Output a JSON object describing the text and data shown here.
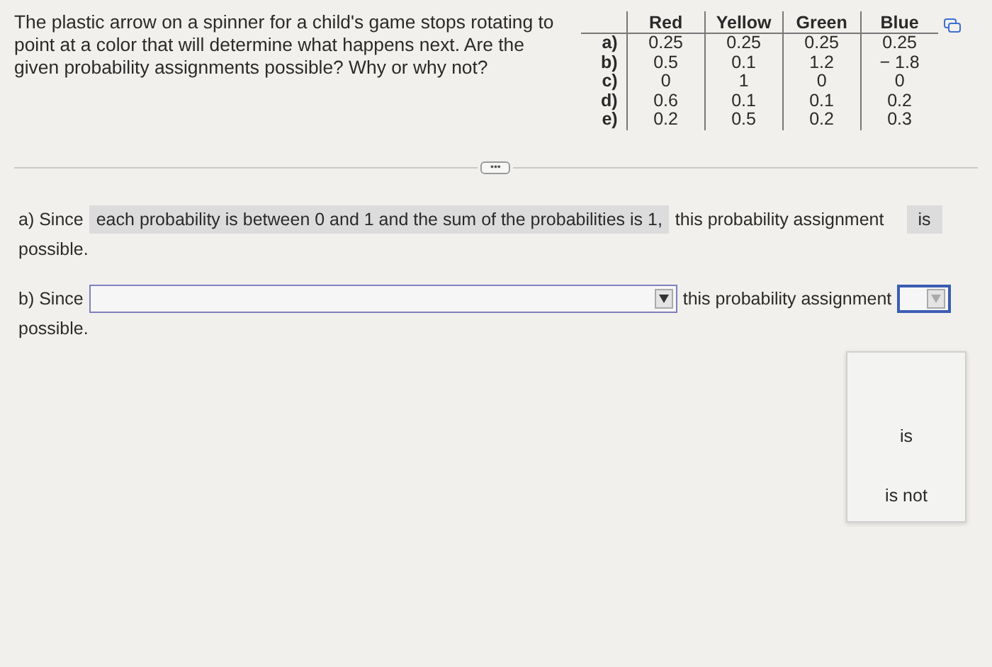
{
  "question": "The plastic arrow on a spinner for a child's game stops rotating to point at a color that will determine what happens next. Are the given probability assignments possible? Why or why not?",
  "table": {
    "columns": [
      "Red",
      "Yellow",
      "Green",
      "Blue"
    ],
    "rows": [
      {
        "label": "a)",
        "cells": [
          "0.25",
          "0.25",
          "0.25",
          "0.25"
        ]
      },
      {
        "label": "b)",
        "cells": [
          "0.5",
          "0.1",
          "1.2",
          "− 1.8"
        ]
      },
      {
        "label": "c)",
        "cells": [
          "0",
          "1",
          "0",
          "0"
        ]
      },
      {
        "label": "d)",
        "cells": [
          "0.6",
          "0.1",
          "0.1",
          "0.2"
        ]
      },
      {
        "label": "e)",
        "cells": [
          "0.2",
          "0.5",
          "0.2",
          "0.3"
        ]
      }
    ]
  },
  "more_button": "•••",
  "answers": [
    {
      "kind": "answered",
      "lead": "a) Since",
      "reason": "each probability is between 0 and 1 and the sum of the probabilities is 1,",
      "middle": "this probability assignment",
      "verdict": "is",
      "ending": "possible."
    },
    {
      "kind": "open",
      "lead": "b) Since",
      "middle": "this probability assignment",
      "ending": "possible.",
      "verdict_expanded": true,
      "options": [
        "is",
        "is not"
      ]
    }
  ]
}
